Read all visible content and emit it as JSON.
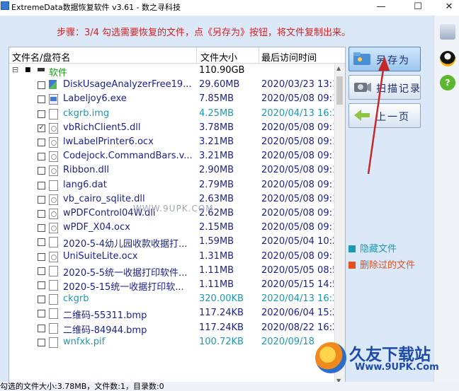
{
  "window": {
    "title": "ExtremeData数据恢复软件 v3.61   -  数之寻科技",
    "minimize": "—",
    "maximize": "☐",
    "close": "✕"
  },
  "step_text": "步骤：3/4 勾选需要恢复的文件，点《另存为》按钮，将文件复制出来。",
  "columns": {
    "name": "文件名/盘符名",
    "size": "文件大小",
    "date": "最后访问时间"
  },
  "root": {
    "expander": "⊟",
    "checkbox": "■",
    "label": "软件",
    "size": "110.90GB"
  },
  "files": [
    {
      "name": "DiskUsageAnalyzerFree19...",
      "size": "29.60MB",
      "date": "2020/03/23 13:1",
      "checked": false,
      "type": "app",
      "color": "blue"
    },
    {
      "name": "Labeljoy6.exe",
      "size": "7.85MB",
      "date": "2020/05/08 09:1",
      "checked": false,
      "type": "exe",
      "color": "blue"
    },
    {
      "name": "ckgrb.img",
      "size": "4.25MB",
      "date": "2020/04/13 16:2",
      "checked": false,
      "type": "doc",
      "color": "teal"
    },
    {
      "name": "vbRichClient5.dll",
      "size": "3.78MB",
      "date": "2020/05/08 09:1",
      "checked": true,
      "type": "dll",
      "color": "blue"
    },
    {
      "name": "lwLabelPrinter6.ocx",
      "size": "3.21MB",
      "date": "2020/05/08 09:1",
      "checked": false,
      "type": "dll",
      "color": "blue"
    },
    {
      "name": "Codejock.CommandBars.v...",
      "size": "3.21MB",
      "date": "2020/05/08 09:1",
      "checked": false,
      "type": "dll",
      "color": "blue"
    },
    {
      "name": "Ribbon.dll",
      "size": "2.90MB",
      "date": "2020/05/08 09:1",
      "checked": false,
      "type": "dll",
      "color": "blue"
    },
    {
      "name": "lang6.dat",
      "size": "2.79MB",
      "date": "2020/05/08 09:1",
      "checked": false,
      "type": "doc",
      "color": "blue"
    },
    {
      "name": "vb_cairo_sqlite.dll",
      "size": "2.63MB",
      "date": "2020/05/08 09:1",
      "checked": false,
      "type": "dll",
      "color": "blue"
    },
    {
      "name": "wPDFControl04W.dll",
      "size": "2.62MB",
      "date": "2020/05/08 09:1",
      "checked": false,
      "type": "dll",
      "color": "blue"
    },
    {
      "name": "wPDF_X04.ocx",
      "size": "2.15MB",
      "date": "2020/05/08 09:1",
      "checked": false,
      "type": "dll",
      "color": "blue"
    },
    {
      "name": "2020-5-4幼儿园收款收据打...",
      "size": "1.59MB",
      "date": "2020/05/04 10:2",
      "checked": false,
      "type": "doc",
      "color": "blue"
    },
    {
      "name": "UniSuiteLite.ocx",
      "size": "1.31MB",
      "date": "2020/05/08 09:1",
      "checked": false,
      "type": "dll",
      "color": "blue"
    },
    {
      "name": "2020-5-5统一收据打印软件...",
      "size": "1.11MB",
      "date": "2020/05/05 08:5",
      "checked": false,
      "type": "doc",
      "color": "blue"
    },
    {
      "name": "2020-5-15统一收据打印软...",
      "size": "1.11MB",
      "date": "2020/05/15 14:5",
      "checked": false,
      "type": "doc",
      "color": "blue"
    },
    {
      "name": "ckgrb",
      "size": "320.00KB",
      "date": "2020/04/13 16:2",
      "checked": false,
      "type": "doc",
      "color": "teal"
    },
    {
      "name": "二维码-55311.bmp",
      "size": "117.24KB",
      "date": "2020/06/04 15:2",
      "checked": false,
      "type": "doc",
      "color": "blue"
    },
    {
      "name": "二维码-84944.bmp",
      "size": "117.24KB",
      "date": "2020/08/22 16:2",
      "checked": false,
      "type": "doc",
      "color": "blue"
    },
    {
      "name": "wnfxk.pif",
      "size": "100.72KB",
      "date": "2020/09/18 ",
      "checked": false,
      "type": "doc",
      "color": "teal"
    }
  ],
  "buttons": {
    "save_as": "另存为",
    "scan_record": "扫描记录",
    "prev_page": "上一页"
  },
  "legend": {
    "hidden": "隐藏文件",
    "deleted": "删除过的文件"
  },
  "status": "勾选的文件大小:3.78MB，文件数:1，目录数:0",
  "watermark": {
    "center": "WWW.9UPK.COM",
    "brand": "久友下载站",
    "url": "Www.9UPK.Com"
  },
  "colors": {
    "step_red": "#d82020",
    "hidden_teal": "#1a9bb0",
    "deleted_orange": "#e4501e",
    "file_blue": "#1a1f8c",
    "root_green": "#1b9b1b"
  }
}
